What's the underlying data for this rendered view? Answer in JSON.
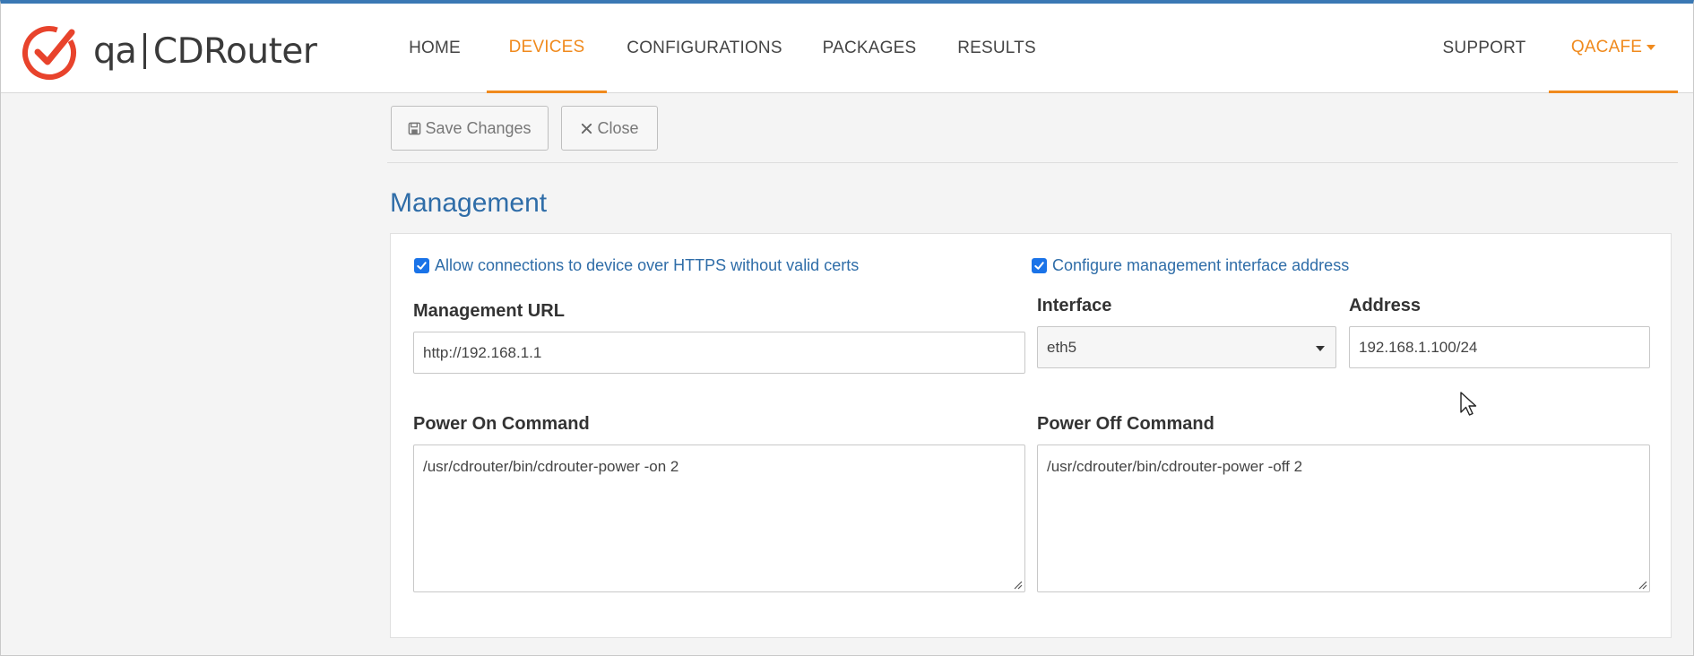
{
  "app": {
    "brand_qa": "qa",
    "brand_name": "CDRouter"
  },
  "nav": {
    "home": "HOME",
    "devices": "DEVICES",
    "configurations": "CONFIGURATIONS",
    "packages": "PACKAGES",
    "results": "RESULTS",
    "support": "SUPPORT",
    "user": "QACAFE",
    "active": "DEVICES"
  },
  "toolbar": {
    "save_label": "Save Changes",
    "close_label": "Close"
  },
  "section": {
    "title": "Management"
  },
  "management": {
    "allow_https_label": "Allow connections to device over HTTPS without valid certs",
    "allow_https_checked": true,
    "configure_iface_label": "Configure management interface address",
    "configure_iface_checked": true,
    "url_label": "Management URL",
    "url_value": "http://192.168.1.1",
    "interface_label": "Interface",
    "interface_value": "eth5",
    "address_label": "Address",
    "address_value": "192.168.1.100/24",
    "power_on_label": "Power On Command",
    "power_on_value": "/usr/cdrouter/bin/cdrouter-power -on 2",
    "power_off_label": "Power Off Command",
    "power_off_value": "/usr/cdrouter/bin/cdrouter-power -off 2"
  },
  "colors": {
    "accent": "#f08a1d",
    "link": "#2f6da8",
    "top_border": "#3a78b4",
    "checkbox": "#1a73e8"
  }
}
